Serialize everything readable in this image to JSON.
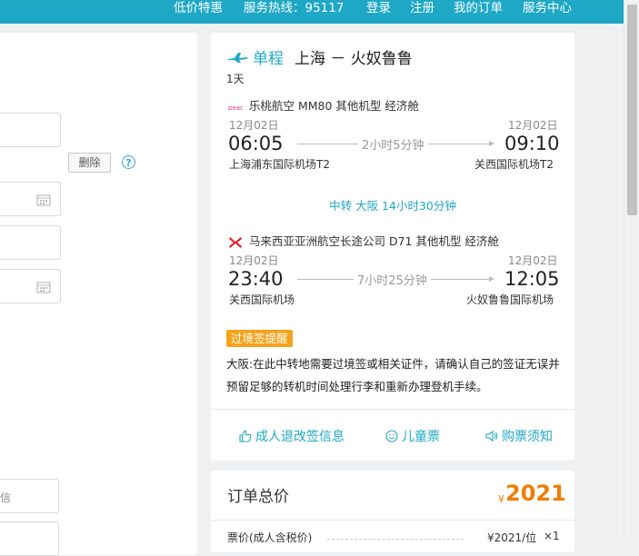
{
  "topnav": {
    "items": [
      "低价特惠",
      "服务热线：95117",
      "登录",
      "注册",
      "我的订单",
      "服务中心"
    ]
  },
  "left": {
    "delete_label": "删除",
    "help_icon": "?",
    "hint": "信"
  },
  "flight": {
    "trip_type": "单程",
    "route": "上海 － 火奴鲁鲁",
    "duration": "1天",
    "transfer": "中转  大阪  14小时30分钟",
    "segments": [
      {
        "airline": "乐桃航空 MM80 其他机型  经济舱",
        "dep_date": "12月02日",
        "dep_time": "06:05",
        "dep_airport": "上海浦东国际机场T2",
        "flight_duration": "2小时5分钟",
        "arr_date": "12月02日",
        "arr_time": "09:10",
        "arr_airport": "关西国际机场T2"
      },
      {
        "airline": "马来西亚亚洲航空长途公司 D71 其他机型  经济舱",
        "dep_date": "12月02日",
        "dep_time": "23:40",
        "dep_airport": "关西国际机场",
        "flight_duration": "7小时25分钟",
        "arr_date": "12月02日",
        "arr_time": "12:05",
        "arr_airport": "火奴鲁鲁国际机场"
      }
    ],
    "visa_tag": "过境签提醒",
    "visa_text": "大阪:在此中转地需要过境签或相关证件，请确认自己的签证无误并预留足够的转机时间处理行李和重新办理登机手续。",
    "links": {
      "refund": "成人退改签信息",
      "child": "儿童票",
      "notice": "购票须知"
    }
  },
  "total": {
    "label": "订单总价",
    "currency": "¥",
    "amount": "2021",
    "price_label": "票价(成人含税价)",
    "price_value": "¥2021/位",
    "price_qty": "×1"
  },
  "colors": {
    "brand": "#1ea8c6",
    "price": "#f07d0a",
    "visa_tag": "#f5a31b"
  }
}
